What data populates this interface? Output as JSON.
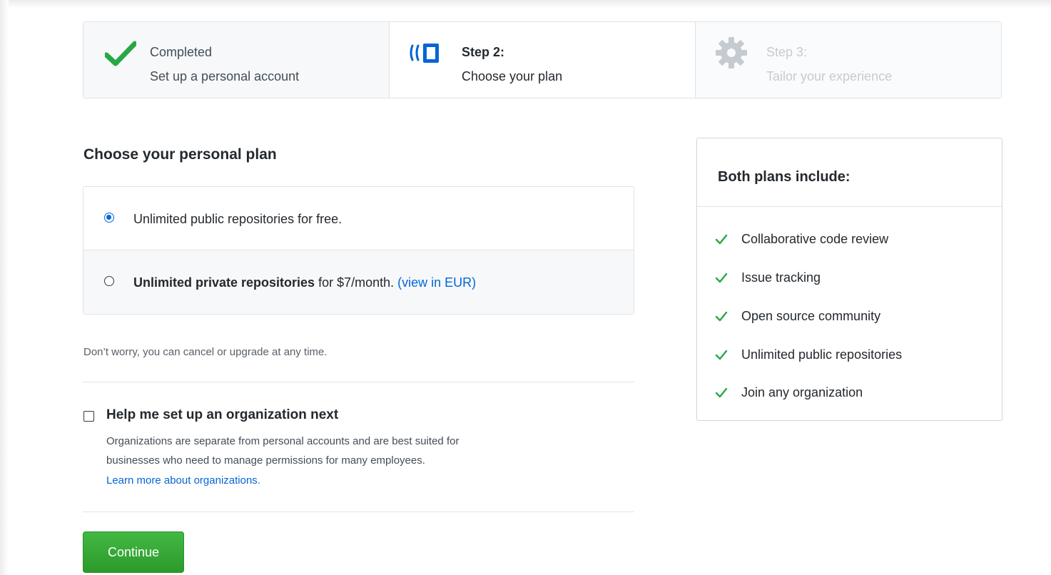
{
  "steps": [
    {
      "title": "Completed",
      "subtitle": "Set up a personal account",
      "state": "done",
      "icon": "checkmark-icon"
    },
    {
      "title": "Step 2:",
      "subtitle": "Choose your plan",
      "state": "current",
      "icon": "devices-icon"
    },
    {
      "title": "Step 3:",
      "subtitle": "Tailor your experience",
      "state": "future",
      "icon": "gear-icon"
    }
  ],
  "plan_section": {
    "heading": "Choose your personal plan",
    "free_plan": {
      "text": "Unlimited public repositories for free.",
      "selected": true
    },
    "paid_plan": {
      "bold": "Unlimited private repositories",
      "text": " for $7/month. ",
      "link": "(view in EUR)",
      "selected": false
    },
    "reassure": "Don’t worry, you can cancel or upgrade at any time."
  },
  "organization": {
    "label": "Help me set up an organization next",
    "checked": false,
    "description_line1": "Organizations are separate from personal accounts and are best suited for",
    "description_line2": "businesses who need to manage permissions for many employees.",
    "link": "Learn more about organizations."
  },
  "continue_label": "Continue",
  "includes": {
    "title": "Both plans include:",
    "items": [
      "Collaborative code review",
      "Issue tracking",
      "Open source community",
      "Unlimited public repositories",
      "Join any organization"
    ]
  },
  "colors": {
    "accent_blue": "#0366d6",
    "check_green": "#28a745",
    "button_green": "#2ea44f"
  }
}
